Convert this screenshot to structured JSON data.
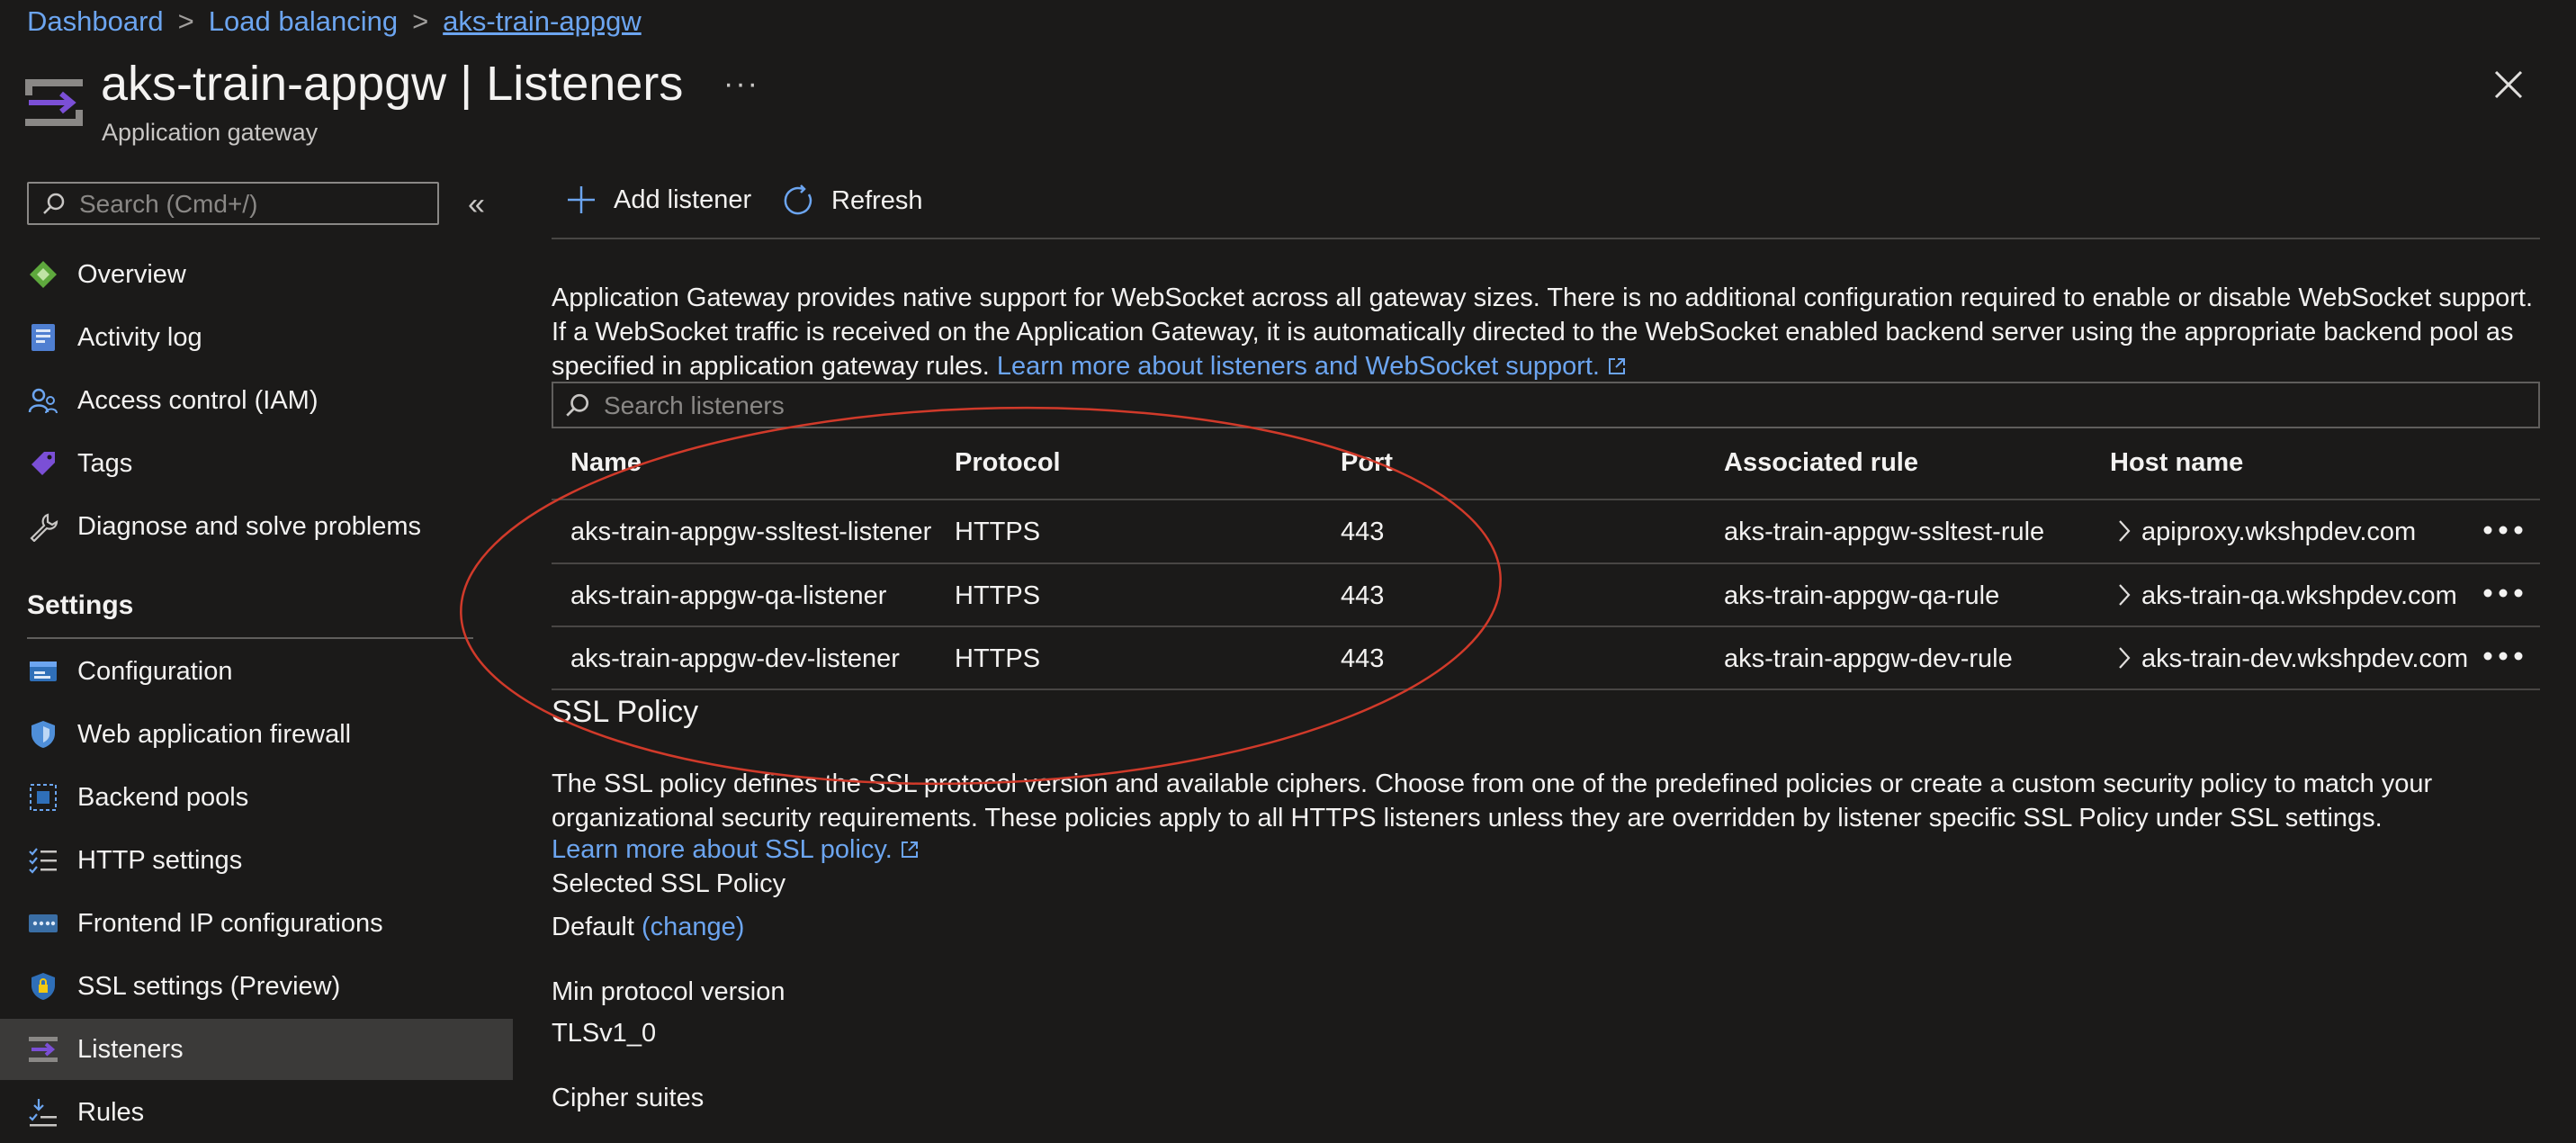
{
  "breadcrumb": {
    "items": [
      "Dashboard",
      "Load balancing"
    ],
    "separator": ">",
    "current": "aks-train-appgw"
  },
  "header": {
    "title": "aks-train-appgw | Listeners",
    "subtitle": "Application gateway",
    "more": "···"
  },
  "sidebar": {
    "search_placeholder": "Search (Cmd+/)",
    "collapse_icon": "«",
    "items": [
      {
        "label": "Overview",
        "icon": "overview-icon"
      },
      {
        "label": "Activity log",
        "icon": "activity-log-icon"
      },
      {
        "label": "Access control (IAM)",
        "icon": "iam-icon"
      },
      {
        "label": "Tags",
        "icon": "tag-icon"
      },
      {
        "label": "Diagnose and solve problems",
        "icon": "wrench-icon"
      }
    ],
    "settings_heading": "Settings",
    "settings_items": [
      {
        "label": "Configuration",
        "icon": "configuration-icon"
      },
      {
        "label": "Web application firewall",
        "icon": "shield-icon"
      },
      {
        "label": "Backend pools",
        "icon": "backend-pool-icon"
      },
      {
        "label": "HTTP settings",
        "icon": "list-icon"
      },
      {
        "label": "Frontend IP configurations",
        "icon": "frontend-ip-icon"
      },
      {
        "label": "SSL settings (Preview)",
        "icon": "ssl-shield-icon"
      },
      {
        "label": "Listeners",
        "icon": "listeners-icon",
        "selected": true
      },
      {
        "label": "Rules",
        "icon": "rules-icon"
      }
    ]
  },
  "toolbar": {
    "add_label": "Add listener",
    "refresh_label": "Refresh"
  },
  "info": {
    "text": "Application Gateway provides native support for WebSocket across all gateway sizes. There is no additional configuration required to enable or disable WebSocket support. If a WebSocket traffic is received on the Application Gateway, it is automatically directed to the WebSocket enabled backend server using the appropriate backend pool as specified in application gateway rules.",
    "link": "Learn more about listeners and WebSocket support."
  },
  "listeners": {
    "search_placeholder": "Search listeners",
    "columns": [
      "Name",
      "Protocol",
      "Port",
      "Associated rule",
      "Host name"
    ],
    "rows": [
      {
        "name": "aks-train-appgw-ssltest-listener",
        "protocol": "HTTPS",
        "port": "443",
        "rule": "aks-train-appgw-ssltest-rule",
        "host": "apiproxy.wkshpdev.com"
      },
      {
        "name": "aks-train-appgw-qa-listener",
        "protocol": "HTTPS",
        "port": "443",
        "rule": "aks-train-appgw-qa-rule",
        "host": "aks-train-qa.wkshpdev.com"
      },
      {
        "name": "aks-train-appgw-dev-listener",
        "protocol": "HTTPS",
        "port": "443",
        "rule": "aks-train-appgw-dev-rule",
        "host": "aks-train-dev.wkshpdev.com"
      }
    ]
  },
  "ssl": {
    "title": "SSL Policy",
    "description": "The SSL policy defines the SSL protocol version and available ciphers. Choose from one of the predefined policies or create a custom security policy to match your organizational security requirements. These policies apply to all HTTPS listeners unless they are overridden by listener specific SSL Policy under SSL settings.",
    "learn_more": "Learn more about SSL policy.",
    "selected_label": "Selected SSL Policy",
    "selected_value": "Default",
    "change_label": "(change)",
    "min_protocol_label": "Min protocol version",
    "min_protocol_value": "TLSv1_0",
    "cipher_label": "Cipher suites"
  },
  "colors": {
    "background": "#1b1a19",
    "link": "#6ca5f0",
    "accent": "#0078d4",
    "annotation": "#d13a2a",
    "selected_nav": "#3b3a39"
  }
}
